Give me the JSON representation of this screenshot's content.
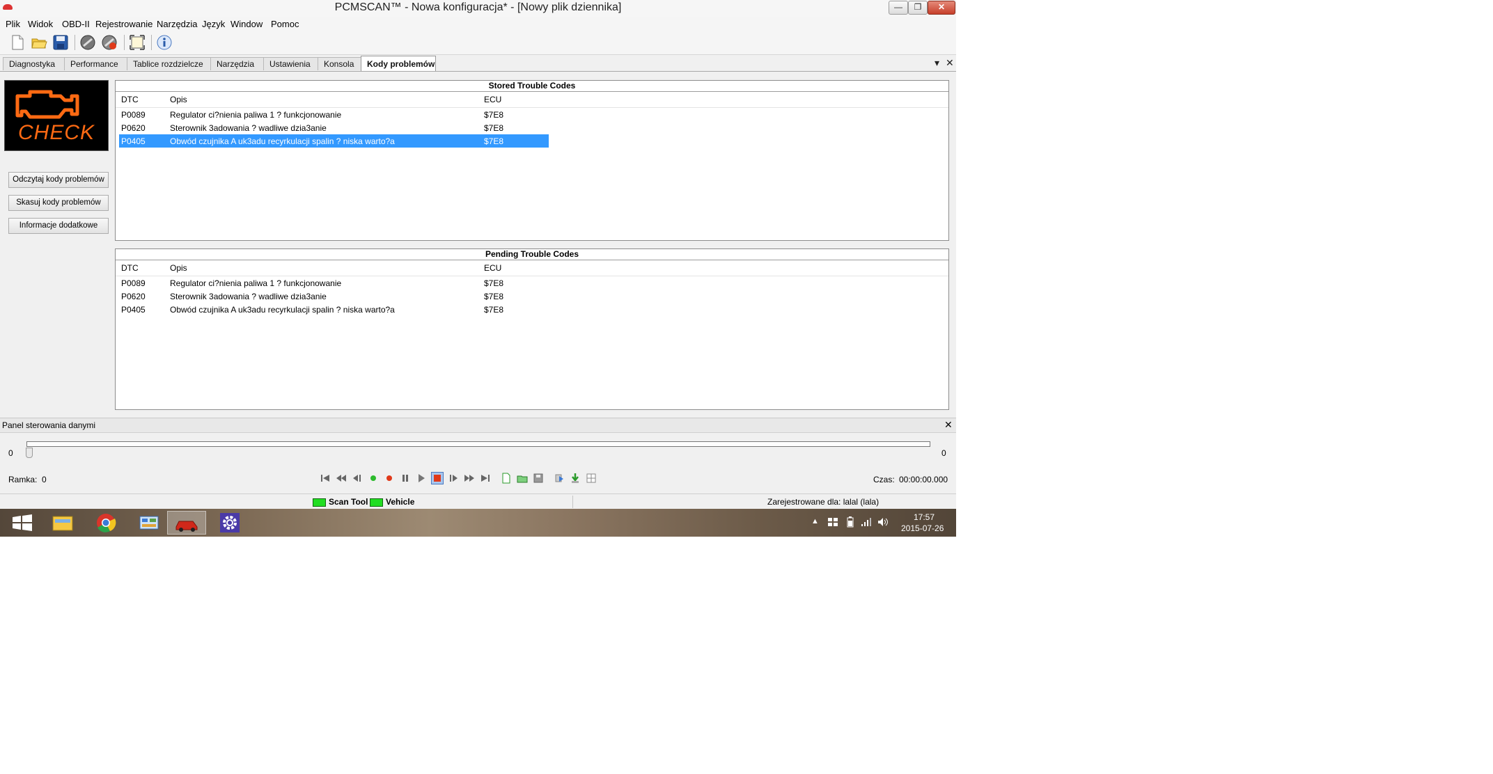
{
  "window": {
    "title": "PCMSCAN™ - Nowa konfiguracja* - [Nowy plik dziennika]",
    "controls": {
      "minimize": "—",
      "maximize": "❐",
      "close": "✕"
    }
  },
  "menu": [
    "Plik",
    "Widok",
    "OBD-II",
    "Rejestrowanie",
    "Narzędzia",
    "Język",
    "Window",
    "Pomoc"
  ],
  "toolbar_icons": [
    "new-file-icon",
    "open-folder-icon",
    "save-icon",
    "connect-icon",
    "disconnect-icon",
    "fit-window-icon",
    "info-icon"
  ],
  "tabs": [
    "Diagnostyka",
    "Performance",
    "Tablice rozdzielcze",
    "Narzędzia",
    "Ustawienia",
    "Konsola",
    "Kody problemów"
  ],
  "active_tab": "Kody problemów",
  "tab_controls": {
    "dropdown": "▾",
    "close": "✕"
  },
  "left": {
    "check_engine_text": "CHECK",
    "buttons": [
      "Odczytaj kody problemów",
      "Skasuj kody problemów",
      "Informacje dodatkowe"
    ]
  },
  "stored": {
    "title": "Stored Trouble Codes",
    "columns": [
      "DTC",
      "Opis",
      "ECU"
    ],
    "rows": [
      {
        "dtc": "P0089",
        "opis": "Regulator ci?nienia paliwa 1 ? funkcjonowanie",
        "ecu": "$7E8"
      },
      {
        "dtc": "P0620",
        "opis": "Sterownik 3adowania ? wadliwe dzia3anie",
        "ecu": "$7E8"
      },
      {
        "dtc": "P0405",
        "opis": "Obwód czujnika A uk3adu recyrkulacji spalin ? niska warto?a",
        "ecu": "$7E8"
      }
    ],
    "selected_row": 3
  },
  "pending": {
    "title": "Pending Trouble Codes",
    "columns": [
      "DTC",
      "Opis",
      "ECU"
    ],
    "rows": [
      {
        "dtc": "P0089",
        "opis": "Regulator ci?nienia paliwa 1 ? funkcjonowanie",
        "ecu": "$7E8"
      },
      {
        "dtc": "P0620",
        "opis": "Sterownik 3adowania ? wadliwe dzia3anie",
        "ecu": "$7E8"
      },
      {
        "dtc": "P0405",
        "opis": "Obwód czujnika A uk3adu recyrkulacji spalin ? niska warto?a",
        "ecu": "$7E8"
      }
    ]
  },
  "data_panel": {
    "title": "Panel sterowania danymi",
    "close": "✕",
    "slider_min": "0",
    "slider_max": "0",
    "frame_label": "Ramka:",
    "frame_value": "0",
    "time_label": "Czas:",
    "time_value": "00:00:00.000"
  },
  "status": {
    "scan_tool": "Scan Tool",
    "vehicle": "Vehicle",
    "registered": "Zarejestrowane dla: lalal (lala)",
    "led_color": "#22dd22"
  },
  "taskbar": {
    "time": "17:57",
    "date": "2015-07-26"
  }
}
